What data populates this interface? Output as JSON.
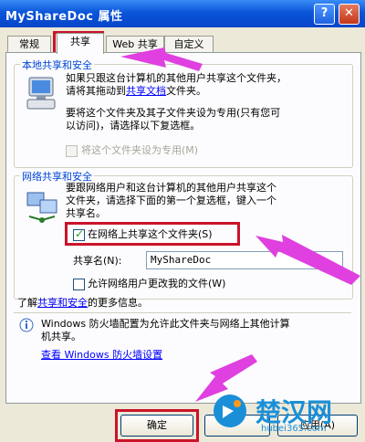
{
  "window": {
    "title": "MyShareDoc 属性"
  },
  "title_buttons": {
    "help": "?",
    "close": "✕"
  },
  "tabs": [
    {
      "label": "常规"
    },
    {
      "label": "共享"
    },
    {
      "label": "Web 共享"
    },
    {
      "label": "自定义"
    }
  ],
  "local": {
    "title": "本地共享和安全",
    "text1_a": "如果只跟这台计算机的其他用户共享这个文件夹，",
    "text1_b": "请将其拖动到",
    "text1_link": "共享文档",
    "text1_c": "文件夹。",
    "text2_a": "要将这个文件夹及其子文件夹设为专用(只有您可",
    "text2_b": "以访问)，请选择以下复选框。",
    "private_label": "将这个文件夹设为专用(M)"
  },
  "network": {
    "title": "网络共享和安全",
    "text_a": "要跟网络用户和这台计算机的其他用户共享这个",
    "text_b": "文件夹，请选择下面的第一个复选框，键入一个",
    "text_c": "共享名。",
    "share_label": "在网络上共享这个文件夹(S)",
    "share_checked": true,
    "share_name_label": "共享名(N):",
    "share_name_value": "MyShareDoc",
    "allow_change_label": "允许网络用户更改我的文件(W)",
    "allow_change_checked": false
  },
  "learn_more": {
    "prefix": "了解",
    "link": "共享和安全",
    "suffix": "的更多信息。"
  },
  "firewall": {
    "info_a": "Windows 防火墙配置为允许此文件夹与网络上其他计算",
    "info_b": "机共享。",
    "link": "查看 Windows 防火墙设置"
  },
  "buttons": {
    "ok": "确定",
    "apply": "应用(A)"
  },
  "watermark": {
    "text": "楚汉网",
    "url": "hubei365.com"
  },
  "colors": {
    "annotation_red": "#c9142a",
    "arrow_magenta": "#e040e0",
    "link_blue": "#0000ff"
  }
}
